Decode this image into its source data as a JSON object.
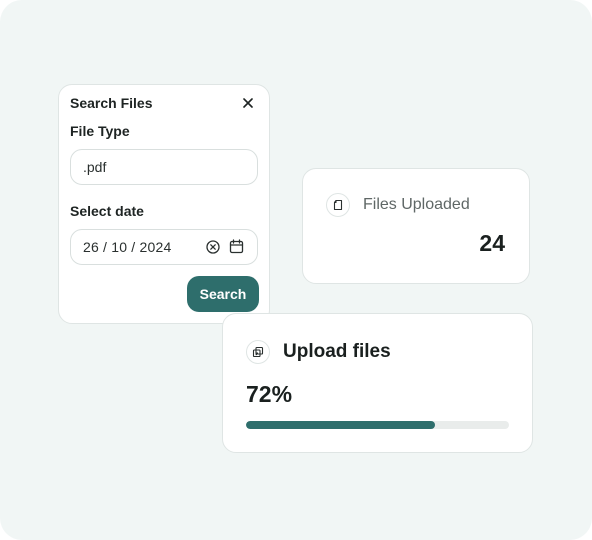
{
  "search_panel": {
    "title": "Search Files",
    "file_type": {
      "label": "File Type",
      "value": ".pdf"
    },
    "date": {
      "label": "Select date",
      "value": "26 / 10 / 2024"
    },
    "search_button": "Search"
  },
  "files_uploaded": {
    "label": "Files Uploaded",
    "count": "24"
  },
  "upload": {
    "title": "Upload files",
    "percent_text": "72%",
    "progress_fraction": 0.72
  },
  "colors": {
    "accent": "#2e6e6c",
    "background": "#f1f6f5",
    "progress_track": "#e9eceb"
  },
  "icons": [
    "close-icon",
    "clear-circle-icon",
    "calendar-icon",
    "file-icon",
    "copy-files-icon"
  ]
}
